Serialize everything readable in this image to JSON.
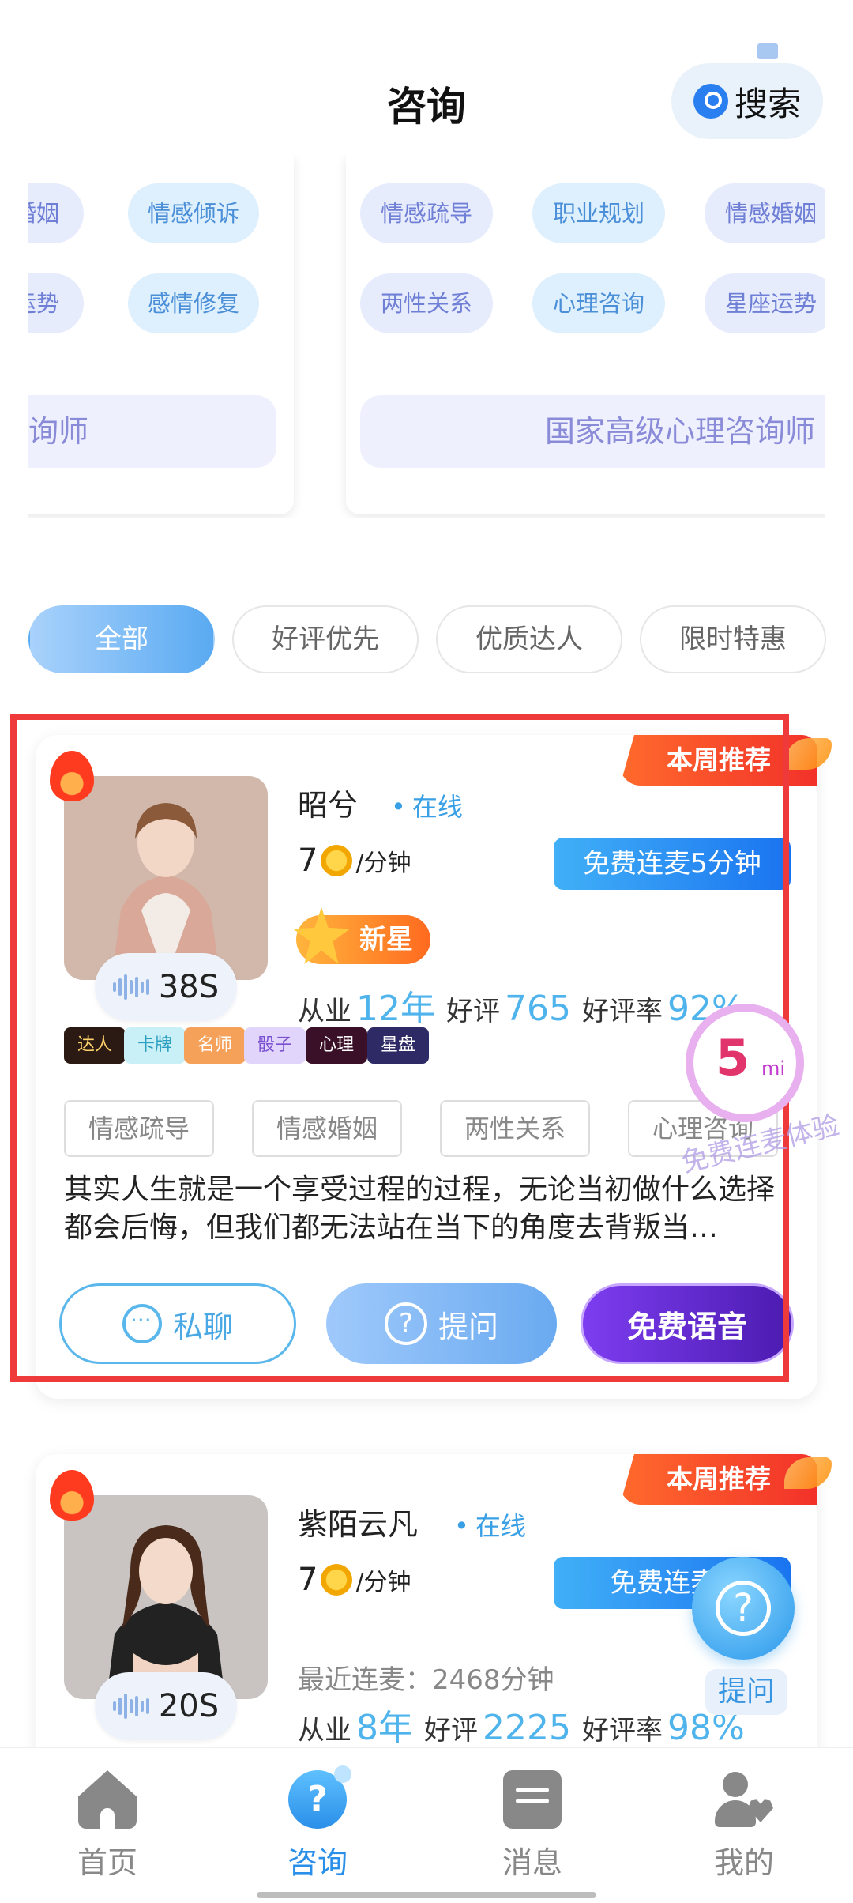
{
  "header": {
    "title": "咨询",
    "search_label": "搜索"
  },
  "banner_left": {
    "tags": [
      "婚姻",
      "情感倾诉",
      "运势",
      "感情修复"
    ],
    "footer": "询师"
  },
  "banner_right": {
    "tags": [
      "情感疏导",
      "职业规划",
      "情感婚姻",
      "两性关系",
      "心理咨询",
      "星座运势"
    ],
    "footer": "国家高级心理咨询师"
  },
  "filters": [
    "全部",
    "好评优先",
    "优质达人",
    "限时特惠"
  ],
  "consultants": [
    {
      "badge": "本周推荐",
      "voice_seconds": "38S",
      "name": "昭兮",
      "status": "在线",
      "price": "7",
      "price_unit": "/分钟",
      "free_offer": "免费连麦5分钟",
      "level": "新星",
      "stats_exp_label": "从业",
      "stats_exp": "12年",
      "stats_reviews_label": "好评",
      "stats_reviews": "765",
      "stats_rate_label": "好评率",
      "stats_rate": "92%",
      "badges": [
        "达人",
        "卡牌",
        "名师",
        "骰子",
        "心理",
        "星盘"
      ],
      "skills": [
        "情感疏导",
        "情感婚姻",
        "两性关系",
        "心理咨询"
      ],
      "description": "其实人生就是一个享受过程的过程，无论当初做什么选择都会后悔，但我们都无法站在当下的角度去背叛当…",
      "actions": {
        "chat": "私聊",
        "ask": "提问",
        "voice": "免费语音"
      }
    },
    {
      "badge": "本周推荐",
      "voice_seconds": "20S",
      "name": "紫陌云凡",
      "status": "在线",
      "price": "7",
      "price_unit": "/分钟",
      "free_offer": "免费连麦5",
      "recent": "最近连麦：2468分钟",
      "stats_exp_label": "从业",
      "stats_exp": "8年",
      "stats_reviews_label": "好评",
      "stats_reviews": "2225",
      "stats_rate_label": "好评率",
      "stats_rate": "98%"
    }
  ],
  "promo": {
    "number": "5",
    "unit": "mi",
    "watermark": "免费连麦体验"
  },
  "float_ask_label": "提问",
  "nav": [
    "首页",
    "咨询",
    "消息",
    "我的"
  ],
  "colors": {
    "accent": "#2a8fe8",
    "highlight": "#ee3a3a",
    "badge_red": "#f2312a"
  }
}
